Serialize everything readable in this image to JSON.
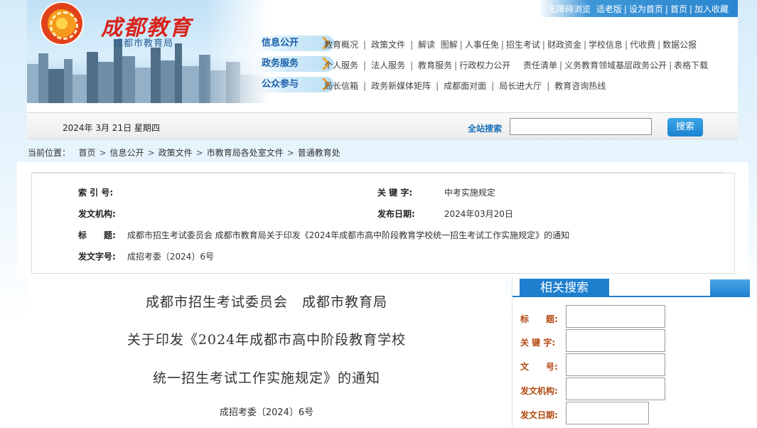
{
  "header": {
    "logo_title": "成都教育",
    "logo_subtitle": "成都市教育局",
    "top_links": [
      "无障碍浏览",
      "适老版",
      "设为首页",
      "首页",
      "加入收藏"
    ]
  },
  "nav": [
    {
      "tag": "信息公开",
      "items": [
        "教育概况",
        "政策文件",
        "解读",
        "图解",
        "人事任免",
        "招生考试",
        "财政资金",
        "学校信息",
        "代收费",
        "数据公报"
      ]
    },
    {
      "tag": "政务服务",
      "items": [
        "个人服务",
        "法人服务",
        "教育服务",
        "行政权力公开",
        "责任清单",
        "义务教育领域基层政务公开",
        "表格下载"
      ]
    },
    {
      "tag": "公众参与",
      "items": [
        "局长信箱",
        "政务新媒体矩阵",
        "成都面对面",
        "局长进大厅",
        "教育咨询热线"
      ]
    }
  ],
  "toolbar": {
    "date": "2024年 3月 21日 星期四",
    "search_label": "全站搜索",
    "search_value": "",
    "search_button": "搜索"
  },
  "breadcrumb": {
    "prefix": "当前位置：",
    "items": [
      "首页",
      "信息公开",
      "政策文件",
      "市教育局各处室文件",
      "普通教育处"
    ]
  },
  "meta": {
    "index_label": "索 引 号:",
    "index_value": "",
    "keyword_label": "关 键 字:",
    "keyword_value": "中考实施规定",
    "org_label": "发文机构:",
    "org_value": "",
    "date_label": "发布日期:",
    "date_value": "2024年03月20日",
    "title_label": "标　　题:",
    "title_value": "成都市招生考试委员会 成都市教育局关于印发《2024年成都市高中阶段教育学校统一招生考试工作实施规定》的通知",
    "docnum_label": "发文字号:",
    "docnum_value": "成招考委〔2024〕6号"
  },
  "document": {
    "title_line1": "成都市招生考试委员会　成都市教育局",
    "title_line2": "关于印发《2024年成都市高中阶段教育学校",
    "title_line3": "统一招生考试工作实施规定》的通知",
    "doc_number": "成招考委〔2024〕6号"
  },
  "related_search": {
    "heading": "相关搜索",
    "fields": [
      {
        "label": "标　　题:",
        "value": ""
      },
      {
        "label": "关 键 字:",
        "value": ""
      },
      {
        "label": "文　　号:",
        "value": ""
      },
      {
        "label": "发文机构:",
        "value": ""
      },
      {
        "label": "发文日期:",
        "value": ""
      }
    ]
  }
}
